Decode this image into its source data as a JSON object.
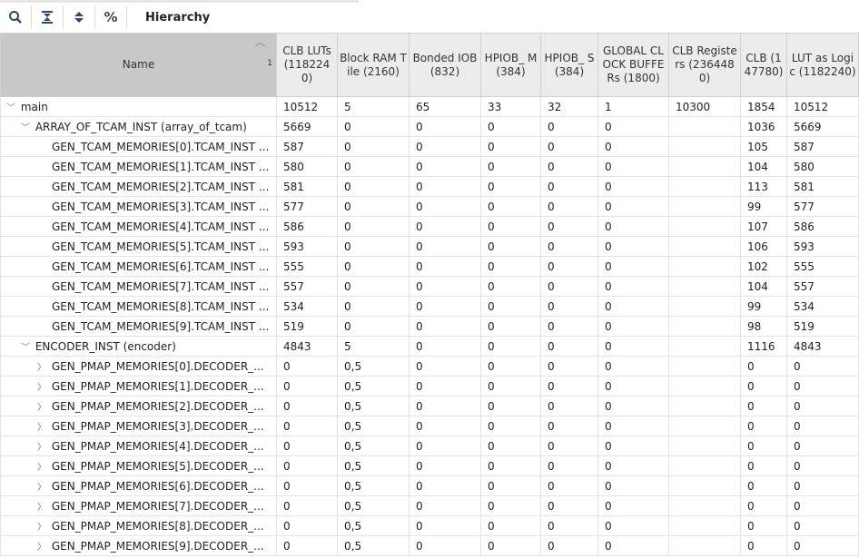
{
  "toolbar": {
    "title": "Hierarchy",
    "percent": "%"
  },
  "columns": [
    "Name",
    "CLB LUTs (1182240)",
    "Block RAM Tile (2160)",
    "Bonded IOB (832)",
    "HPIOB_ M (384)",
    "HPIOB_ S (384)",
    "GLOBAL CLOCK BUFFERs (1800)",
    "CLB Registers (2364480)",
    "CLB (147780)",
    "LUT as Logic (1182240)"
  ],
  "sort_index": "1",
  "rows": [
    {
      "name": "main",
      "level": 0,
      "exp": "open",
      "v": [
        "10512",
        "5",
        "65",
        "33",
        "32",
        "1",
        "10300",
        "1854",
        "10512"
      ]
    },
    {
      "name": "ARRAY_OF_TCAM_INST (array_of_tcam)",
      "level": 1,
      "exp": "open",
      "v": [
        "5669",
        "0",
        "0",
        "0",
        "0",
        "0",
        "",
        "1036",
        "5669"
      ]
    },
    {
      "name": "GEN_TCAM_MEMORIES[0].TCAM_INST ...",
      "level": 2,
      "exp": "",
      "v": [
        "587",
        "0",
        "0",
        "0",
        "0",
        "0",
        "",
        "105",
        "587"
      ]
    },
    {
      "name": "GEN_TCAM_MEMORIES[1].TCAM_INST ...",
      "level": 2,
      "exp": "",
      "v": [
        "580",
        "0",
        "0",
        "0",
        "0",
        "0",
        "",
        "104",
        "580"
      ]
    },
    {
      "name": "GEN_TCAM_MEMORIES[2].TCAM_INST ...",
      "level": 2,
      "exp": "",
      "v": [
        "581",
        "0",
        "0",
        "0",
        "0",
        "0",
        "",
        "113",
        "581"
      ]
    },
    {
      "name": "GEN_TCAM_MEMORIES[3].TCAM_INST ...",
      "level": 2,
      "exp": "",
      "v": [
        "577",
        "0",
        "0",
        "0",
        "0",
        "0",
        "",
        "99",
        "577"
      ]
    },
    {
      "name": "GEN_TCAM_MEMORIES[4].TCAM_INST ...",
      "level": 2,
      "exp": "",
      "v": [
        "586",
        "0",
        "0",
        "0",
        "0",
        "0",
        "",
        "107",
        "586"
      ]
    },
    {
      "name": "GEN_TCAM_MEMORIES[5].TCAM_INST ...",
      "level": 2,
      "exp": "",
      "v": [
        "593",
        "0",
        "0",
        "0",
        "0",
        "0",
        "",
        "106",
        "593"
      ]
    },
    {
      "name": "GEN_TCAM_MEMORIES[6].TCAM_INST ...",
      "level": 2,
      "exp": "",
      "v": [
        "555",
        "0",
        "0",
        "0",
        "0",
        "0",
        "",
        "102",
        "555"
      ]
    },
    {
      "name": "GEN_TCAM_MEMORIES[7].TCAM_INST ...",
      "level": 2,
      "exp": "",
      "v": [
        "557",
        "0",
        "0",
        "0",
        "0",
        "0",
        "",
        "104",
        "557"
      ]
    },
    {
      "name": "GEN_TCAM_MEMORIES[8].TCAM_INST ...",
      "level": 2,
      "exp": "",
      "v": [
        "534",
        "0",
        "0",
        "0",
        "0",
        "0",
        "",
        "99",
        "534"
      ]
    },
    {
      "name": "GEN_TCAM_MEMORIES[9].TCAM_INST ...",
      "level": 2,
      "exp": "",
      "v": [
        "519",
        "0",
        "0",
        "0",
        "0",
        "0",
        "",
        "98",
        "519"
      ]
    },
    {
      "name": "ENCODER_INST (encoder)",
      "level": 1,
      "exp": "open",
      "v": [
        "4843",
        "5",
        "0",
        "0",
        "0",
        "0",
        "",
        "1116",
        "4843"
      ]
    },
    {
      "name": "GEN_PMAP_MEMORIES[0].DECODER_...",
      "level": 2,
      "exp": "closed",
      "v": [
        "0",
        "0,5",
        "0",
        "0",
        "0",
        "0",
        "",
        "0",
        "0"
      ]
    },
    {
      "name": "GEN_PMAP_MEMORIES[1].DECODER_...",
      "level": 2,
      "exp": "closed",
      "v": [
        "0",
        "0,5",
        "0",
        "0",
        "0",
        "0",
        "",
        "0",
        "0"
      ]
    },
    {
      "name": "GEN_PMAP_MEMORIES[2].DECODER_...",
      "level": 2,
      "exp": "closed",
      "v": [
        "0",
        "0,5",
        "0",
        "0",
        "0",
        "0",
        "",
        "0",
        "0"
      ]
    },
    {
      "name": "GEN_PMAP_MEMORIES[3].DECODER_...",
      "level": 2,
      "exp": "closed",
      "v": [
        "0",
        "0,5",
        "0",
        "0",
        "0",
        "0",
        "",
        "0",
        "0"
      ]
    },
    {
      "name": "GEN_PMAP_MEMORIES[4].DECODER_...",
      "level": 2,
      "exp": "closed",
      "v": [
        "0",
        "0,5",
        "0",
        "0",
        "0",
        "0",
        "",
        "0",
        "0"
      ]
    },
    {
      "name": "GEN_PMAP_MEMORIES[5].DECODER_...",
      "level": 2,
      "exp": "closed",
      "v": [
        "0",
        "0,5",
        "0",
        "0",
        "0",
        "0",
        "",
        "0",
        "0"
      ]
    },
    {
      "name": "GEN_PMAP_MEMORIES[6].DECODER_...",
      "level": 2,
      "exp": "closed",
      "v": [
        "0",
        "0,5",
        "0",
        "0",
        "0",
        "0",
        "",
        "0",
        "0"
      ]
    },
    {
      "name": "GEN_PMAP_MEMORIES[7].DECODER_...",
      "level": 2,
      "exp": "closed",
      "v": [
        "0",
        "0,5",
        "0",
        "0",
        "0",
        "0",
        "",
        "0",
        "0"
      ]
    },
    {
      "name": "GEN_PMAP_MEMORIES[8].DECODER_...",
      "level": 2,
      "exp": "closed",
      "v": [
        "0",
        "0,5",
        "0",
        "0",
        "0",
        "0",
        "",
        "0",
        "0"
      ]
    },
    {
      "name": "GEN_PMAP_MEMORIES[9].DECODER_...",
      "level": 2,
      "exp": "closed",
      "v": [
        "0",
        "0,5",
        "0",
        "0",
        "0",
        "0",
        "",
        "0",
        "0"
      ]
    }
  ]
}
